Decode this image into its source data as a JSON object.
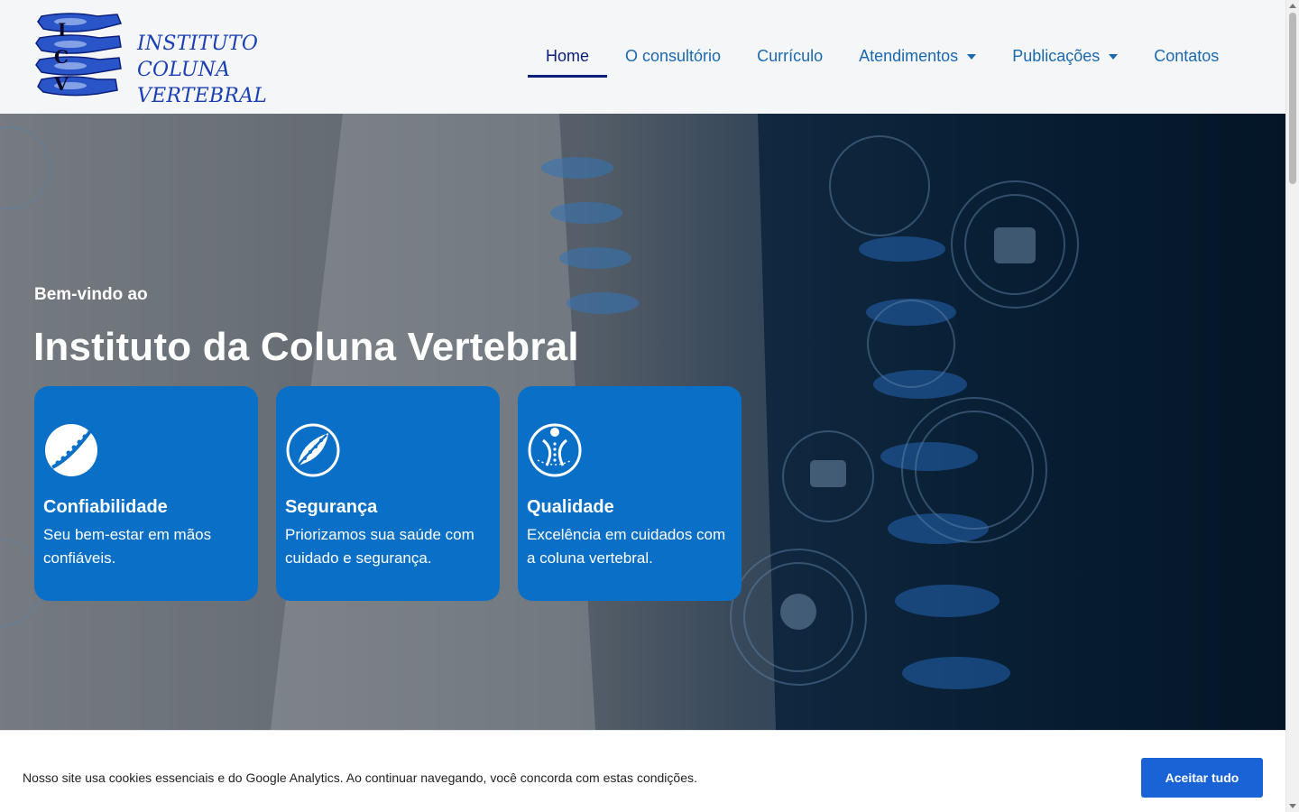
{
  "logo": {
    "letters": [
      "I",
      "C",
      "V"
    ],
    "lines": [
      "INSTITUTO",
      "COLUNA",
      "VERTEBRAL"
    ]
  },
  "nav": {
    "items": [
      {
        "label": "Home",
        "active": true,
        "dropdown": false
      },
      {
        "label": "O consultório",
        "active": false,
        "dropdown": false
      },
      {
        "label": "Currículo",
        "active": false,
        "dropdown": false
      },
      {
        "label": "Atendimentos",
        "active": false,
        "dropdown": true
      },
      {
        "label": "Publicações",
        "active": false,
        "dropdown": true
      },
      {
        "label": "Contatos",
        "active": false,
        "dropdown": false
      }
    ]
  },
  "hero": {
    "welcome": "Bem-vindo ao",
    "title": "Instituto da Coluna Vertebral",
    "cards": [
      {
        "icon": "spine-leaf-icon",
        "title": "Confiabilidade",
        "text": "Seu bem-estar em mãos confiáveis."
      },
      {
        "icon": "spine-feather-icon",
        "title": "Segurança",
        "text": "Priorizamos sua saúde com cuidado e segurança."
      },
      {
        "icon": "person-spine-icon",
        "title": "Qualidade",
        "text": "Excelência em cuidados com a coluna vertebral."
      }
    ]
  },
  "cookie": {
    "text": "Nosso site usa cookies essenciais e do Google Analytics. Ao continuar navegando, você concorda com estas condições.",
    "button": "Aceitar tudo"
  },
  "colors": {
    "brand_blue": "#1a3fb5",
    "card_blue": "#0a6fc6",
    "nav_active": "#0b1f7a",
    "button_blue": "#1a63d6"
  }
}
